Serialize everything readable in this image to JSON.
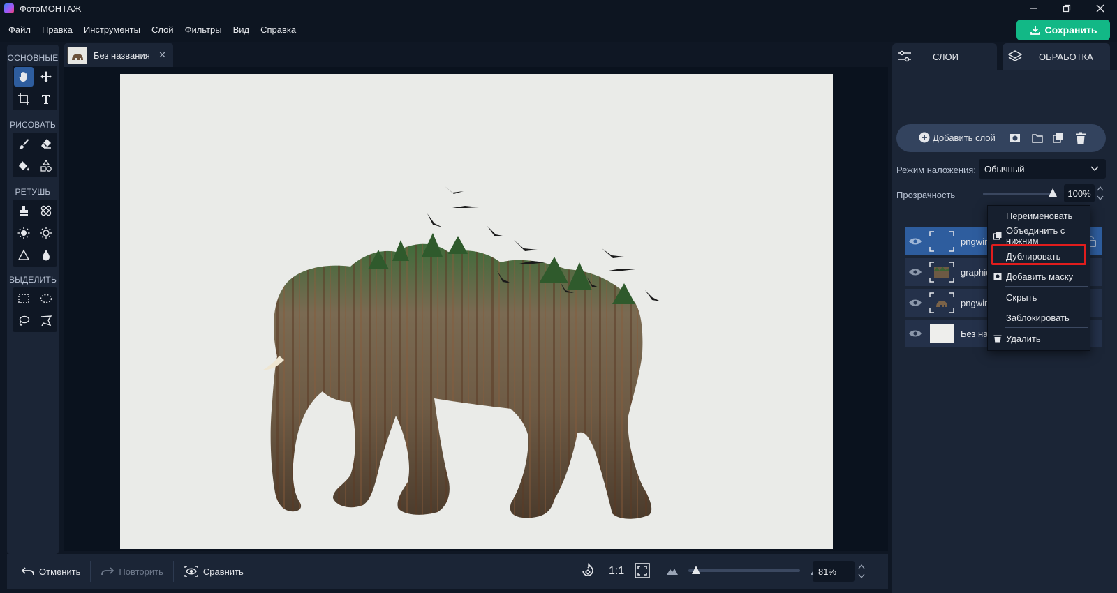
{
  "window": {
    "title": "ФотоМОНТАЖ",
    "controls": [
      "minimize",
      "restore",
      "close"
    ]
  },
  "menu": {
    "items": [
      "Файл",
      "Правка",
      "Инструменты",
      "Слой",
      "Фильтры",
      "Вид",
      "Справка"
    ],
    "save_label": "Сохранить"
  },
  "toolbar": {
    "sections": [
      {
        "title": "ОСНОВНЫЕ",
        "tools": [
          "hand-tool",
          "move-tool",
          "crop-tool",
          "text-tool"
        ]
      },
      {
        "title": "РИСОВАТЬ",
        "tools": [
          "brush-tool",
          "eraser-tool",
          "fill-tool",
          "shapes-tool"
        ]
      },
      {
        "title": "РЕТУШЬ",
        "tools": [
          "stamp-tool",
          "healing-tool",
          "lighten-tool",
          "darken-tool",
          "sharpen-tool",
          "blur-tool"
        ]
      },
      {
        "title": "ВЫДЕЛИТЬ",
        "tools": [
          "rect-select-tool",
          "ellipse-select-tool",
          "lasso-tool",
          "polygon-lasso-tool"
        ]
      }
    ],
    "active_tool": "hand-tool"
  },
  "document_tab": {
    "name": "Без названия"
  },
  "bottom_bar": {
    "undo_label": "Отменить",
    "redo_label": "Повторить",
    "compare_label": "Сравнить",
    "one_to_one_label": "1:1",
    "zoom_value": "81%",
    "zoom_fraction": 0.07
  },
  "right_panel": {
    "tabs": [
      {
        "label": "СЛОИ",
        "active": true
      },
      {
        "label": "ОБРАБОТКА",
        "active": false
      }
    ],
    "add_layer_label": "Добавить слой",
    "blend_mode_label": "Режим наложения:",
    "blend_mode_value": "Обычный",
    "opacity_label": "Прозрачность",
    "opacity_value": "100%",
    "opacity_fraction": 1.0,
    "layers": [
      {
        "name": "pngwing",
        "selected": true
      },
      {
        "name": "graphic",
        "selected": false
      },
      {
        "name": "pngwin",
        "selected": false
      },
      {
        "name": "Без наз",
        "selected": false
      }
    ]
  },
  "context_menu": {
    "items": [
      {
        "label": "Переименовать",
        "icon": null
      },
      {
        "label": "Объединить с нижним",
        "icon": "merge-icon"
      },
      {
        "label": "Дублировать",
        "icon": null,
        "highlighted": true
      },
      {
        "label": "Добавить маску",
        "icon": "mask-icon"
      },
      {
        "label": "Скрыть",
        "icon": null
      },
      {
        "label": "Заблокировать",
        "icon": null
      },
      {
        "label": "Удалить",
        "icon": "trash-icon"
      }
    ]
  },
  "colors": {
    "accent_save": "#12b886",
    "selected_layer": "#2e5d9e",
    "highlight_border": "#e11d1d"
  }
}
